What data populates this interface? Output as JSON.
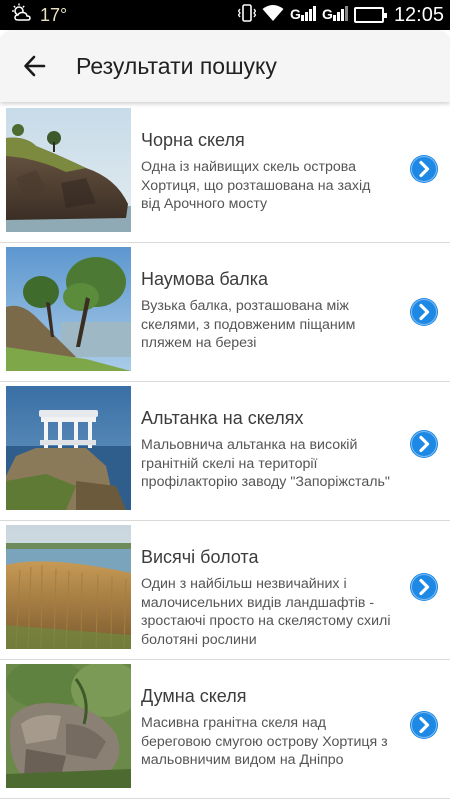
{
  "status_bar": {
    "temperature": "17°",
    "time": "12:05",
    "battery": "99",
    "battery_level": 0.99,
    "icons": [
      "weather-icon",
      "vibrate-icon",
      "wifi-icon",
      "signal-icon",
      "signal-icon",
      "battery-icon"
    ]
  },
  "header": {
    "back_icon": "arrow-left-icon",
    "title": "Результати пошуку"
  },
  "results": [
    {
      "title": "Чорна скеля",
      "description": "Одна із найвищих скель острова Хортиця, що розташована на захід від Арочного мосту",
      "action_icon": "chevron-right-icon"
    },
    {
      "title": "Наумова балка",
      "description": "Вузька балка, розташована між скелями, з подовженим піщаним пляжем на березі",
      "action_icon": "chevron-right-icon"
    },
    {
      "title": "Альтанка на скелях",
      "description": "Мальовнича альтанка на високій гранітній скелі на території профілакторію заводу \"Запоріжсталь\"",
      "action_icon": "chevron-right-icon"
    },
    {
      "title": "Висячі болота",
      "description": "Один з найбільш незвичайних і малочисельних видів ландшафтів - зростаючі просто на скелястому схилі болотяні рослини",
      "action_icon": "chevron-right-icon"
    },
    {
      "title": "Думна скеля",
      "description": "Масивна гранітна скеля над береговою смугою острову Хортиця з мальовничим видом на Дніпро",
      "action_icon": "chevron-right-icon"
    }
  ],
  "colors": {
    "accent": "#1e88e5",
    "status_bar": "#000000",
    "app_bar": "#f5f5f5",
    "divider": "#d9d9d9"
  }
}
